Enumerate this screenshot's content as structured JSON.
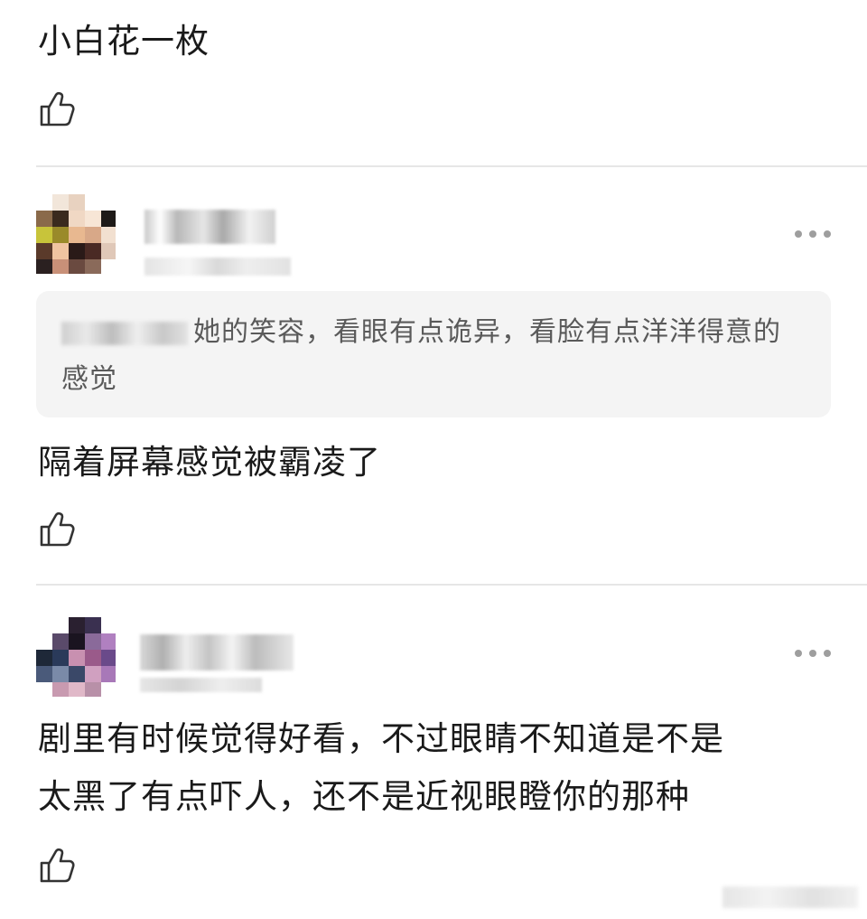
{
  "comments": [
    {
      "text": "小白花一枚"
    },
    {
      "quote": {
        "text": "她的笑容，看眼有点诡异，看脸有点洋洋得意的感觉"
      },
      "text": "隔着屏幕感觉被霸凌了"
    },
    {
      "text_line1": "剧里有时候觉得好看，不过眼睛不知道是不是",
      "text_line2": "太黑了有点吓人，还不是近视眼瞪你的那种"
    }
  ],
  "icons": {
    "like": "thumbs-up-icon",
    "more": "more-dots-icon",
    "avatar": "pixelated-avatar"
  },
  "colors": {
    "text": "#1a1a1a",
    "quote_bg": "#f4f4f4",
    "quote_text": "#5a5a5a",
    "divider": "#e6e6e6",
    "icon": "#9e9e9e"
  }
}
